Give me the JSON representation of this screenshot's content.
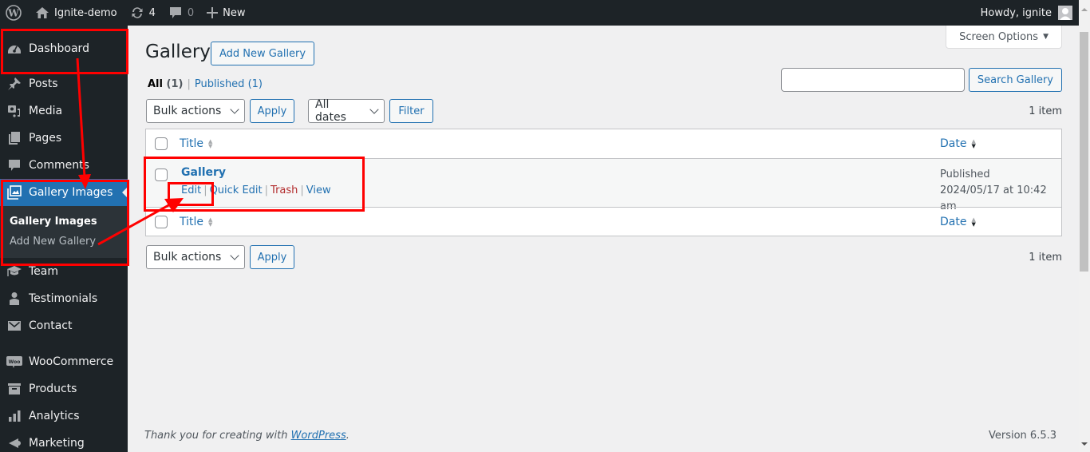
{
  "adminbar": {
    "site_name": "Ignite-demo",
    "updates_count": "4",
    "comments_count": "0",
    "new_label": "New",
    "greeting": "Howdy, ignite"
  },
  "sidebar": {
    "items": [
      {
        "label": "Dashboard",
        "icon": "dashboard-icon"
      },
      {
        "label": "Posts",
        "icon": "pin-icon"
      },
      {
        "label": "Media",
        "icon": "media-icon"
      },
      {
        "label": "Pages",
        "icon": "pages-icon"
      },
      {
        "label": "Comments",
        "icon": "comment-icon"
      },
      {
        "label": "Gallery Images",
        "icon": "gallery-icon",
        "current": true
      },
      {
        "label": "Team",
        "icon": "graduation-cap-icon"
      },
      {
        "label": "Testimonials",
        "icon": "person-icon"
      },
      {
        "label": "Contact",
        "icon": "envelope-icon"
      },
      {
        "label": "WooCommerce",
        "icon": "woo-icon"
      },
      {
        "label": "Products",
        "icon": "archive-icon"
      },
      {
        "label": "Analytics",
        "icon": "bar-chart-icon"
      },
      {
        "label": "Marketing",
        "icon": "megaphone-icon"
      }
    ],
    "submenu": [
      {
        "label": "Gallery Images",
        "current": true
      },
      {
        "label": "Add New Gallery"
      }
    ]
  },
  "main": {
    "screen_options": "Screen Options",
    "title": "Gallery",
    "add_new": "Add New Gallery",
    "views": [
      {
        "label": "All",
        "count": "(1)",
        "current": true
      },
      {
        "label": "Published",
        "count": "(1)"
      }
    ],
    "views_separator": "|",
    "search_value": "",
    "search_button": "Search Gallery",
    "bulk_actions": "Bulk actions",
    "apply": "Apply",
    "date_filter": "All dates",
    "filter": "Filter",
    "items_count": "1 item",
    "columns": {
      "title": "Title",
      "date": "Date"
    },
    "rows": [
      {
        "title": "Gallery",
        "actions": [
          "Edit",
          "Quick Edit",
          "Trash",
          "View"
        ],
        "status": "Published",
        "date": "2024/05/17 at 10:42 am"
      }
    ]
  },
  "footer": {
    "thanks_prefix": "Thank you for creating with ",
    "thanks_link": "WordPress",
    "thanks_suffix": ".",
    "version": "Version 6.5.3"
  },
  "annotation_color": "#ff0000"
}
